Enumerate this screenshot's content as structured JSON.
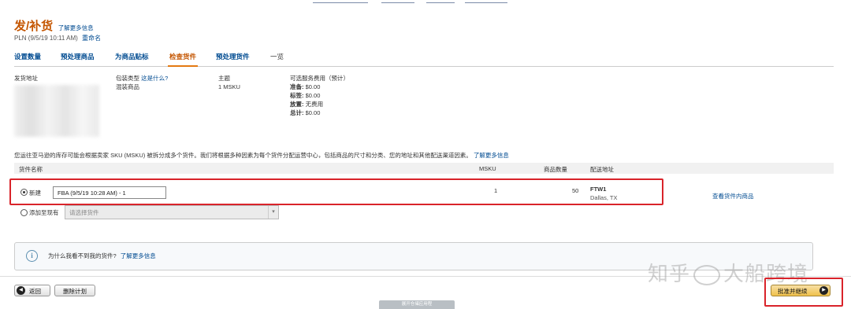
{
  "header": {
    "title": "发/补货",
    "learn_more": "了解更多信息",
    "plan_name": "PLN (9/5/19 10:11 AM)",
    "rename": "重命名"
  },
  "tabs": [
    {
      "label": "设置数量"
    },
    {
      "label": "预处理商品"
    },
    {
      "label": "为商品贴标"
    },
    {
      "label": "检查货件"
    },
    {
      "label": "预处理货件"
    },
    {
      "label": "一览"
    }
  ],
  "summary": {
    "ship_from_label": "发货地址",
    "packing_label": "包装类型",
    "packing_help": "这是什么?",
    "packing_value": "混装商品",
    "contents_label": "主题",
    "contents_value": "1 MSKU",
    "fees_label": "可选服务费用（预计）",
    "fees": [
      {
        "name": "准备:",
        "value": "$0.00"
      },
      {
        "name": "标签:",
        "value": "$0.00"
      },
      {
        "name": "放置:",
        "value": "无费用"
      },
      {
        "name": "总计:",
        "value": "$0.00"
      }
    ]
  },
  "notice": {
    "text": "您运往亚马逊的库存可能会根据卖家 SKU (MSKU) 被拆分成多个货件。我们将根据多种因素为每个货件分配运营中心，包括商品的尺寸和分类、您的地址和其他配送渠道因素。",
    "link": "了解更多信息"
  },
  "table": {
    "headers": {
      "name": "货件名称",
      "msku": "MSKU",
      "units": "商品数量",
      "ship_to": "配送地址"
    },
    "rows": [
      {
        "option_label": "新建",
        "shipment_name": "FBA (9/5/19 10:28 AM) - 1",
        "msku": "1",
        "units": "50",
        "fc_code": "FTW1",
        "fc_city": "Dallas, TX",
        "view_link": "查看货件内商品"
      }
    ],
    "add_existing_label": "添加至现有",
    "select_placeholder": "请选择货件"
  },
  "info": {
    "question": "为什么我看不到我的货件?",
    "link": "了解更多信息"
  },
  "buttons": {
    "back": "返回",
    "delete_plan": "删除计划",
    "approve_continue": "批准并继续"
  },
  "footer_tab": "展开仓储应用程",
  "watermark": {
    "left": "知乎",
    "right": "大船跨境"
  },
  "colors": {
    "brand_orange": "#c45500",
    "link_blue": "#004b91",
    "highlight_red": "#d9232a",
    "primary_button": "#f0c14b"
  }
}
